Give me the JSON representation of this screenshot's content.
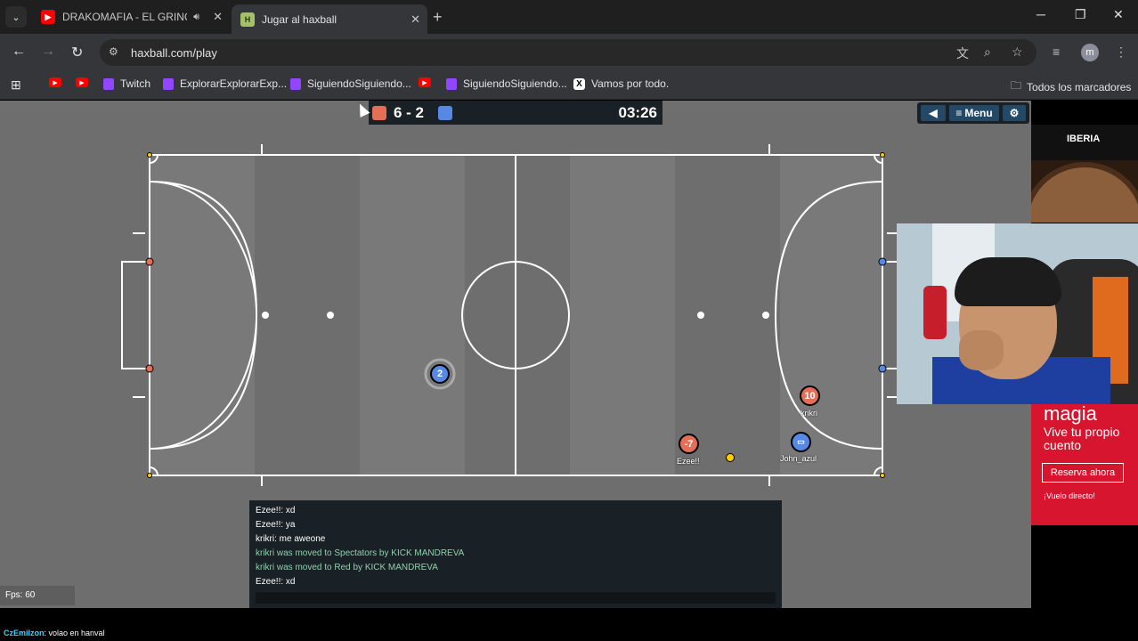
{
  "browser": {
    "tabs": [
      {
        "title": "DRAKOMAFIA - EL GRINCH",
        "icon": "youtube-icon",
        "audio": true,
        "active": false
      },
      {
        "title": "Jugar al haxball",
        "icon": "haxball-icon",
        "favicon_letter": "H",
        "active": true
      }
    ],
    "url": "haxball.com/play",
    "profile_initial": "m",
    "bookmarks": [
      {
        "label": "",
        "icon": "youtube-icon"
      },
      {
        "label": "",
        "icon": "youtube-icon"
      },
      {
        "label": "Twitch",
        "icon": "twitch-icon"
      },
      {
        "label": "ExplorarExplorarExp...",
        "icon": "twitch-icon"
      },
      {
        "label": "SiguiendoSiguiendo...",
        "icon": "twitch-icon"
      },
      {
        "label": "",
        "icon": "youtube-icon"
      },
      {
        "label": "SiguiendoSiguiendo...",
        "icon": "twitch-icon"
      },
      {
        "label": "Vamos por todo.",
        "icon": "x-icon",
        "icon_letter": "X"
      },
      {
        "label": "Todos los marcadores",
        "icon": "folder-icon"
      }
    ]
  },
  "game": {
    "score": "6 - 2",
    "time": "03:26",
    "colors": {
      "red": "#e56e56",
      "blue": "#5689e5",
      "ball": "#ffcc00",
      "pitch": "#6e6e6e"
    },
    "menu_label": "Menu",
    "players": [
      {
        "team": "blue",
        "number": "2",
        "name": ""
      },
      {
        "team": "red",
        "number": "10",
        "name": "krikri"
      },
      {
        "team": "red",
        "number": "-7",
        "name": "Ezee!!"
      },
      {
        "team": "blue",
        "number": "",
        "name": "John_azul"
      }
    ],
    "chat": [
      {
        "text": "Ezee!!: xd",
        "type": "message"
      },
      {
        "text": "Ezee!!: ya",
        "type": "message"
      },
      {
        "text": "krikri: me aweone",
        "type": "message"
      },
      {
        "text": "krikri was moved to Spectators by KICK MANDREVA",
        "type": "notice"
      },
      {
        "text": "krikri was moved to Red by KICK MANDREVA",
        "type": "notice"
      },
      {
        "text": "Ezee!!: xd",
        "type": "message"
      }
    ],
    "fps": "Fps: 60"
  },
  "ads": {
    "top_brand": "IBERIA",
    "bottom_title": "magia",
    "bottom_text": "Vive tu propio cuento",
    "bottom_button": "Reserva ahora",
    "bottom_tag": "¡Vuelo directo!"
  },
  "overlay": {
    "chat_user": "CzEmilzon",
    "chat_message": ": volao en hanval"
  }
}
